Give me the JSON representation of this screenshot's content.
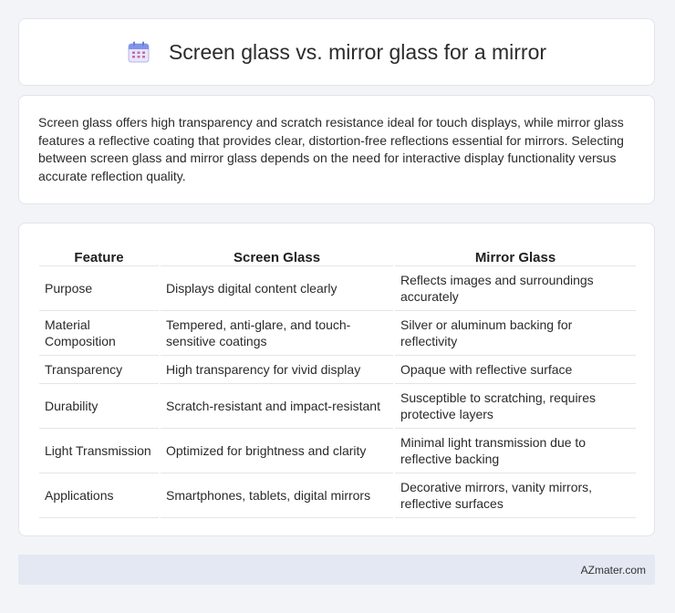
{
  "header": {
    "title": "Screen glass vs. mirror glass for a mirror",
    "icon": "calendar-icon"
  },
  "intro": {
    "text": "Screen glass offers high transparency and scratch resistance ideal for touch displays, while mirror glass features a reflective coating that provides clear, distortion-free reflections essential for mirrors. Selecting between screen glass and mirror glass depends on the need for interactive display functionality versus accurate reflection quality."
  },
  "table": {
    "headers": [
      "Feature",
      "Screen Glass",
      "Mirror Glass"
    ],
    "rows": [
      [
        "Purpose",
        "Displays digital content clearly",
        "Reflects images and surroundings accurately"
      ],
      [
        "Material Composition",
        "Tempered, anti-glare, and touch-sensitive coatings",
        "Silver or aluminum backing for reflectivity"
      ],
      [
        "Transparency",
        "High transparency for vivid display",
        "Opaque with reflective surface"
      ],
      [
        "Durability",
        "Scratch-resistant and impact-resistant",
        "Susceptible to scratching, requires protective layers"
      ],
      [
        "Light Transmission",
        "Optimized for brightness and clarity",
        "Minimal light transmission due to reflective backing"
      ],
      [
        "Applications",
        "Smartphones, tablets, digital mirrors",
        "Decorative mirrors, vanity mirrors, reflective surfaces"
      ]
    ]
  },
  "footer": {
    "text": "AZmater.com"
  },
  "colors": {
    "background": "#f3f4f8",
    "card": "#ffffff",
    "footer": "#e4e8f3",
    "icon_accent": "#8a7fe0"
  }
}
